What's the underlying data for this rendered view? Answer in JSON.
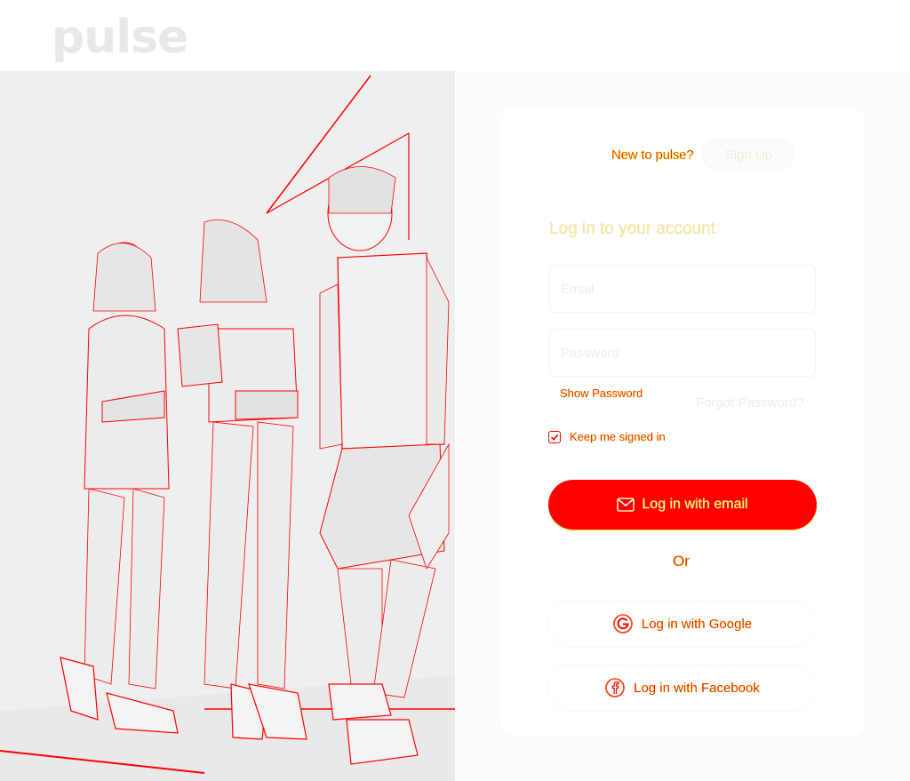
{
  "brand": {
    "logo_text": "pulse"
  },
  "signup": {
    "question": "New to pulse?",
    "button_label": "Sign Up"
  },
  "login": {
    "title": "Log in to your account",
    "email_placeholder": "Email",
    "password_placeholder": "Password",
    "show_password_label": "Show Password",
    "forgot_password_label": "Forgot Password?",
    "keep_signed_in_label": "Keep me signed in",
    "keep_signed_in_checked": true,
    "email_button_label": "Log in with email",
    "divider_label": "Or",
    "google_button_label": "Log in with Google",
    "facebook_button_label": "Log in with Facebook"
  },
  "icons": {
    "mail": "mail-icon",
    "google": "google-icon",
    "facebook": "facebook-icon",
    "check": "check-icon"
  },
  "colors": {
    "accent": "#ff0000",
    "accent_outline": "#ffd800"
  }
}
